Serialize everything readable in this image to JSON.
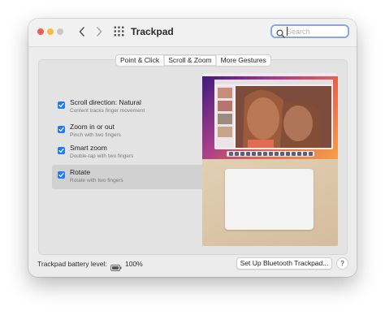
{
  "window": {
    "title": "Trackpad"
  },
  "toolbar": {
    "back_icon": "chevron-left-icon",
    "forward_icon": "chevron-right-icon",
    "show_all_icon": "grid-icon"
  },
  "search": {
    "placeholder": "Search",
    "value": ""
  },
  "tabs": [
    {
      "label": "Point & Click",
      "active": false
    },
    {
      "label": "Scroll & Zoom",
      "active": true
    },
    {
      "label": "More Gestures",
      "active": false
    }
  ],
  "options": [
    {
      "label": "Scroll direction: Natural",
      "description": "Content tracks finger movement",
      "checked": true,
      "selected": false
    },
    {
      "label": "Zoom in or out",
      "description": "Pinch with two fingers",
      "checked": true,
      "selected": false
    },
    {
      "label": "Smart zoom",
      "description": "Double-tap with two fingers",
      "checked": true,
      "selected": false
    },
    {
      "label": "Rotate",
      "description": "Rotate with two fingers",
      "checked": true,
      "selected": true
    }
  ],
  "footer": {
    "battery_label": "Trackpad battery level:",
    "battery_value": "100%",
    "bluetooth_button": "Set Up Bluetooth Trackpad...",
    "help_button": "?"
  },
  "colors": {
    "accent": "#1f7bf5",
    "close": "#ee5c54",
    "minimize": "#f6bd3c"
  }
}
